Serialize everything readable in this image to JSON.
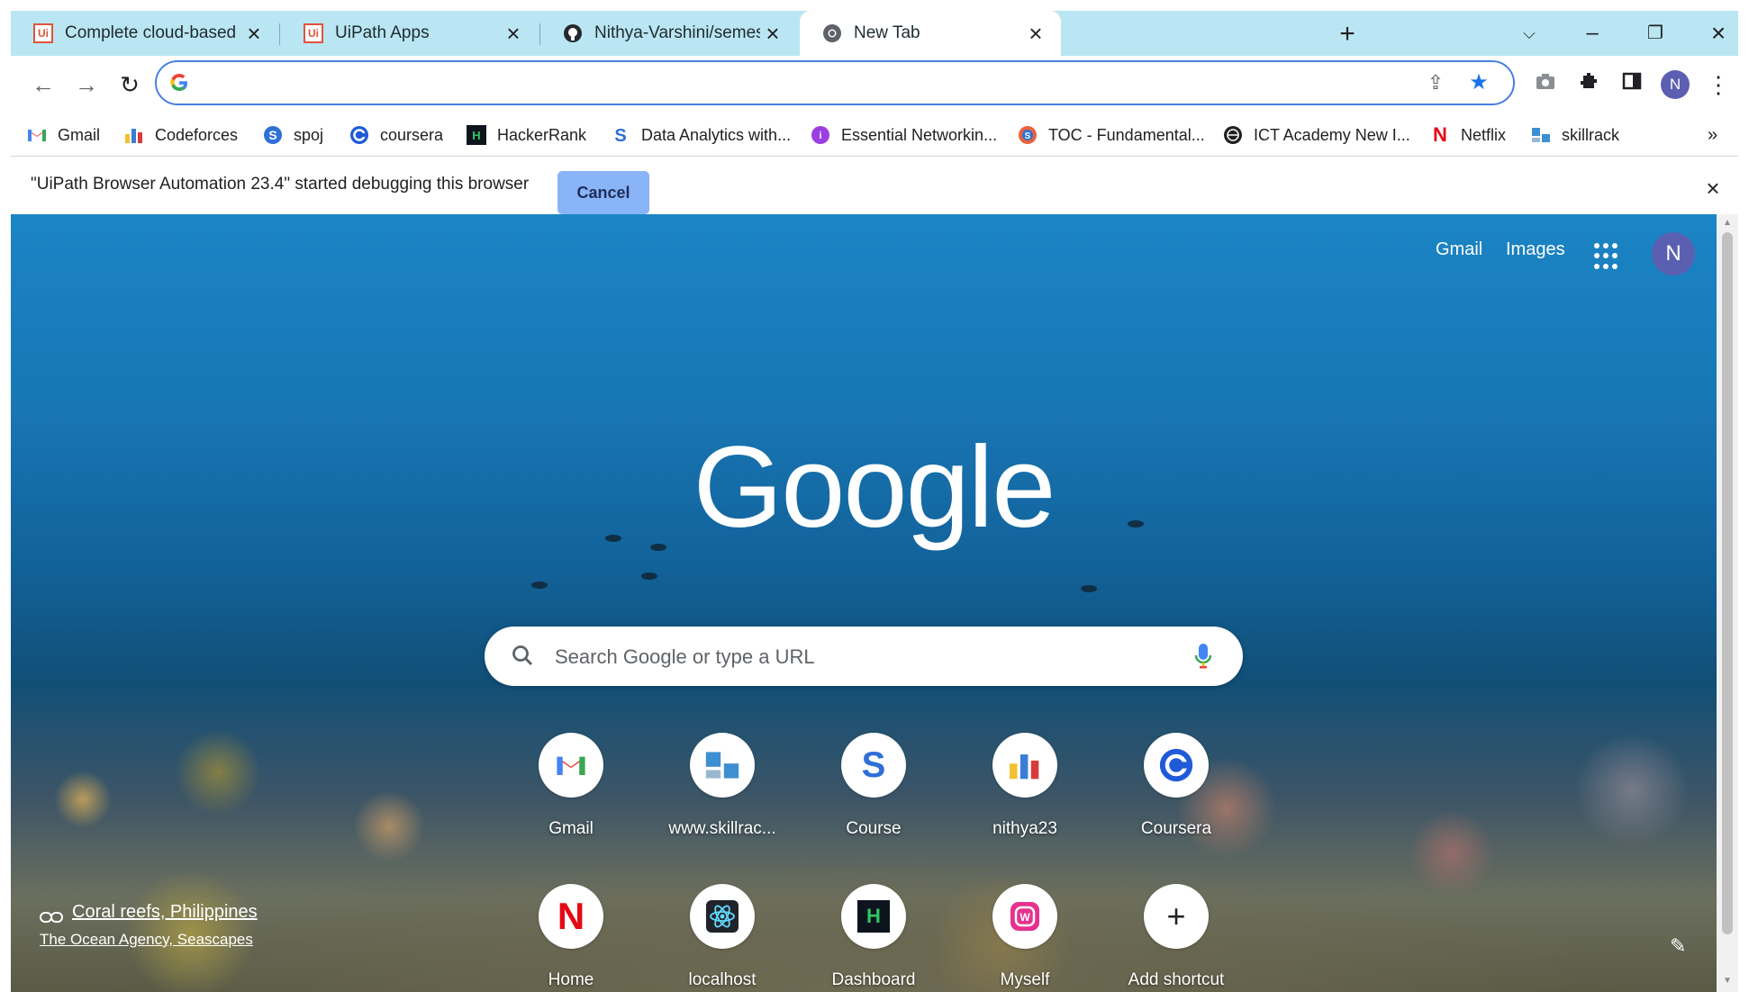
{
  "tabs": [
    {
      "title": "Complete cloud-based enterprise",
      "icon": "uipath-icon"
    },
    {
      "title": "UiPath Apps",
      "icon": "uipath-icon"
    },
    {
      "title": "Nithya-Varshini/semester_analysi",
      "icon": "github-icon"
    },
    {
      "title": "New Tab",
      "icon": "chrome-icon",
      "active": true
    }
  ],
  "favicon_text": {
    "uipath": "Ui",
    "hackerrank": "H",
    "netflix": "N",
    "signin_avatar": "N"
  },
  "omnibox": {
    "value": "",
    "placeholder": ""
  },
  "bookmarks": [
    {
      "label": "Gmail",
      "icon": "gmail-icon"
    },
    {
      "label": "Codeforces",
      "icon": "codeforces-icon"
    },
    {
      "label": "spoj",
      "icon": "spoj-icon"
    },
    {
      "label": "coursera",
      "icon": "coursera-icon"
    },
    {
      "label": "HackerRank",
      "icon": "hackerrank-icon"
    },
    {
      "label": "Data Analytics with...",
      "icon": "s-icon"
    },
    {
      "label": "Essential Networkin...",
      "icon": "purple-icon"
    },
    {
      "label": "TOC - Fundamental...",
      "icon": "toc-icon"
    },
    {
      "label": "ICT Academy New I...",
      "icon": "globe-icon"
    },
    {
      "label": "Netflix",
      "icon": "netflix-icon"
    },
    {
      "label": "skillrack",
      "icon": "skillrack-icon"
    }
  ],
  "debug_bar": {
    "message": "\"UiPath Browser Automation 23.4\" started debugging this browser",
    "cancel_label": "Cancel"
  },
  "ntp": {
    "gmail_link": "Gmail",
    "images_link": "Images",
    "avatar_letter": "N",
    "logo": "Google",
    "search_placeholder": "Search Google or type a URL",
    "shortcuts": [
      {
        "label": "Gmail",
        "icon": "gmail-icon"
      },
      {
        "label": "www.skillrac...",
        "icon": "skillrack-icon"
      },
      {
        "label": "Course",
        "icon": "s-icon",
        "glyph": "S"
      },
      {
        "label": "nithya23",
        "icon": "chart-icon"
      },
      {
        "label": "Coursera",
        "icon": "coursera-icon"
      },
      {
        "label": "Home",
        "icon": "netflix-icon",
        "glyph": "N"
      },
      {
        "label": "localhost",
        "icon": "react-icon"
      },
      {
        "label": "Dashboard",
        "icon": "hackerrank-icon",
        "glyph": "H"
      },
      {
        "label": "Myself",
        "icon": "webflow-icon"
      },
      {
        "label": "Add shortcut",
        "icon": "plus-icon",
        "glyph": "+"
      }
    ],
    "attribution_title": "Coral reefs, Philippines",
    "attribution_credit": "The Ocean Agency, Seascapes"
  },
  "colors": {
    "tabstrip": "#b9e6f2",
    "accent": "#4a7fe0",
    "cancel_button": "#8ab4f8",
    "avatar": "#5b5fb2"
  }
}
